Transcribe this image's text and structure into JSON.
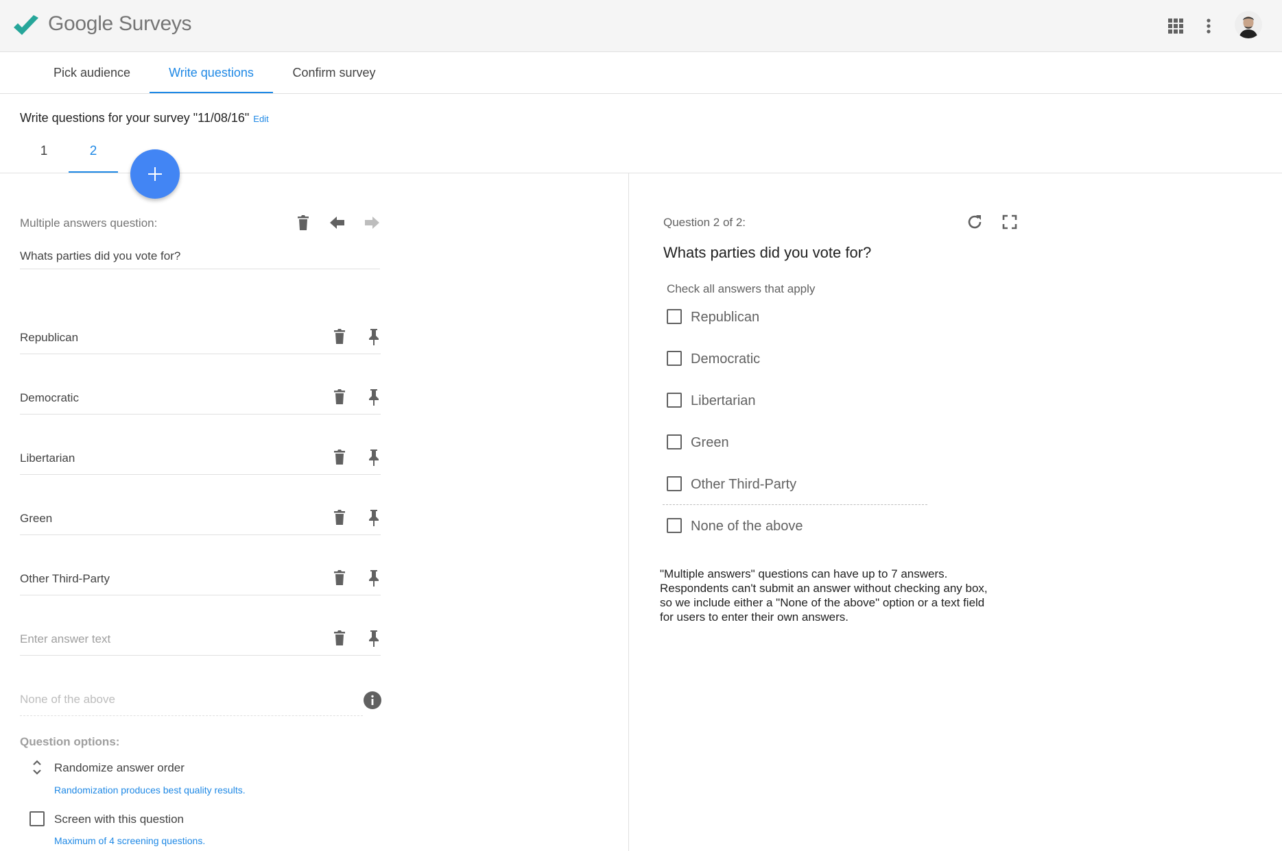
{
  "app": {
    "brand": "Google Surveys",
    "icons": [
      "checkmark-logo",
      "apps-grid-icon",
      "more-vert-icon",
      "avatar"
    ],
    "accent_color": "#1e88e5",
    "fab_color": "#4285f4",
    "logo_color": "#26a69a"
  },
  "steps": [
    "Pick audience",
    "Write questions",
    "Confirm survey"
  ],
  "active_step": "Write questions",
  "survey": {
    "title": "Write questions for your survey \"11/08/16\"",
    "edit_label": "Edit"
  },
  "question_tabs": [
    "1",
    "2"
  ],
  "active_question_tab": "2",
  "editor": {
    "type_label": "Multiple answers question:",
    "question_text": "Whats parties did you vote for?",
    "answers": [
      "Republican",
      "Democratic",
      "Libertarian",
      "Green",
      "Other Third-Party"
    ],
    "answer_placeholder": "Enter answer text",
    "none_option": "None of the above",
    "options_title": "Question options:",
    "randomize_label": "Randomize answer order",
    "randomize_hint": "Randomization produces best quality results.",
    "screen_label": "Screen with this question",
    "screen_hint": "Maximum of 4 screening questions."
  },
  "preview": {
    "counter": "Question 2 of 2:",
    "question": "Whats parties did you vote for?",
    "hint": "Check all answers that apply",
    "options": [
      "Republican",
      "Democratic",
      "Libertarian",
      "Green",
      "Other Third-Party",
      "None of the above"
    ],
    "note_lines": [
      "\"Multiple answers\" questions can have up to 7 answers.",
      "Respondents can't submit an answer without checking any box,",
      "so we include either a \"None of the above\" option or a text field",
      "for users to enter their own answers."
    ]
  }
}
